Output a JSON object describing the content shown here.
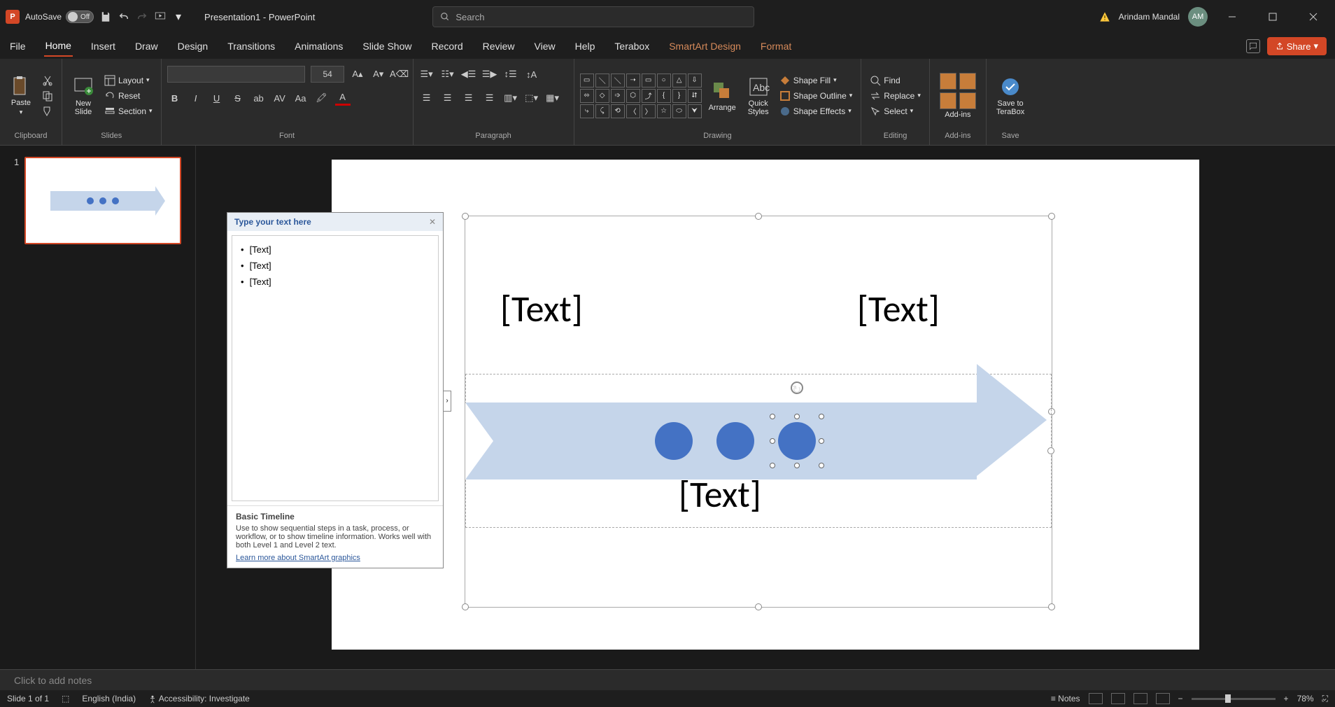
{
  "titlebar": {
    "autosave_label": "AutoSave",
    "autosave_state": "Off",
    "doc_title": "Presentation1 - PowerPoint",
    "search_placeholder": "Search",
    "user_name": "Arindam Mandal",
    "user_initials": "AM"
  },
  "menu": {
    "tabs": [
      "File",
      "Home",
      "Insert",
      "Draw",
      "Design",
      "Transitions",
      "Animations",
      "Slide Show",
      "Record",
      "Review",
      "View",
      "Help",
      "Terabox"
    ],
    "contextual_tabs": [
      "SmartArt Design",
      "Format"
    ],
    "active_tab": "Home",
    "share_label": "Share"
  },
  "ribbon": {
    "clipboard": {
      "paste": "Paste",
      "label": "Clipboard"
    },
    "slides": {
      "new_slide": "New\nSlide",
      "layout": "Layout",
      "reset": "Reset",
      "section": "Section",
      "label": "Slides"
    },
    "font": {
      "size": "54",
      "label": "Font"
    },
    "paragraph": {
      "label": "Paragraph"
    },
    "drawing": {
      "arrange": "Arrange",
      "quick_styles": "Quick\nStyles",
      "shape_fill": "Shape Fill",
      "shape_outline": "Shape Outline",
      "shape_effects": "Shape Effects",
      "label": "Drawing"
    },
    "editing": {
      "find": "Find",
      "replace": "Replace",
      "select": "Select",
      "label": "Editing"
    },
    "addins": {
      "addins": "Add-ins",
      "label": "Add-ins"
    },
    "save": {
      "terabox": "Save to\nTeraBox",
      "label": "Save"
    }
  },
  "thumb": {
    "slide_num": "1"
  },
  "text_pane": {
    "title": "Type your text here",
    "items": [
      "[Text]",
      "[Text]",
      "[Text]"
    ],
    "desc_title": "Basic Timeline",
    "desc_body": "Use to show sequential steps in a task, process, or workflow, or to show timeline information. Works well with both Level 1 and Level 2 text.",
    "link": "Learn more about SmartArt graphics"
  },
  "smartart": {
    "text_top_left": "[Text]",
    "text_top_right": "[Text]",
    "text_bottom": "[Text]"
  },
  "notes": {
    "placeholder": "Click to add notes"
  },
  "statusbar": {
    "slide_info": "Slide 1 of 1",
    "language": "English (India)",
    "accessibility": "Accessibility: Investigate",
    "notes_label": "Notes",
    "zoom": "78%"
  }
}
